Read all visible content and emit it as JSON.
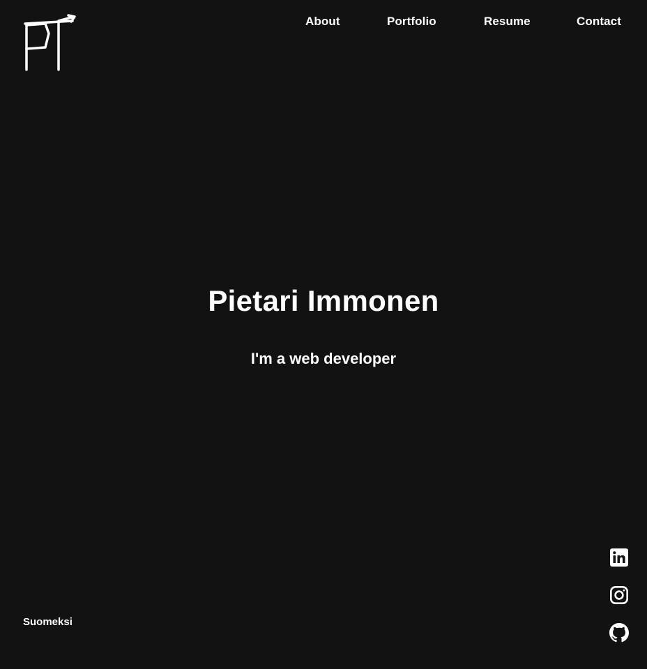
{
  "header": {
    "logo_icon": "pi-monogram-logo-icon",
    "nav": [
      {
        "label": "About"
      },
      {
        "label": "Portfolio"
      },
      {
        "label": "Resume"
      },
      {
        "label": "Contact"
      }
    ]
  },
  "hero": {
    "title": "Pietari Immonen",
    "subtitle": "I'm a web developer"
  },
  "footer": {
    "language_toggle": "Suomeksi",
    "social": [
      {
        "icon": "linkedin-icon"
      },
      {
        "icon": "instagram-icon"
      },
      {
        "icon": "github-icon"
      }
    ]
  },
  "colors": {
    "background": "#121212",
    "foreground": "#ffffff"
  }
}
